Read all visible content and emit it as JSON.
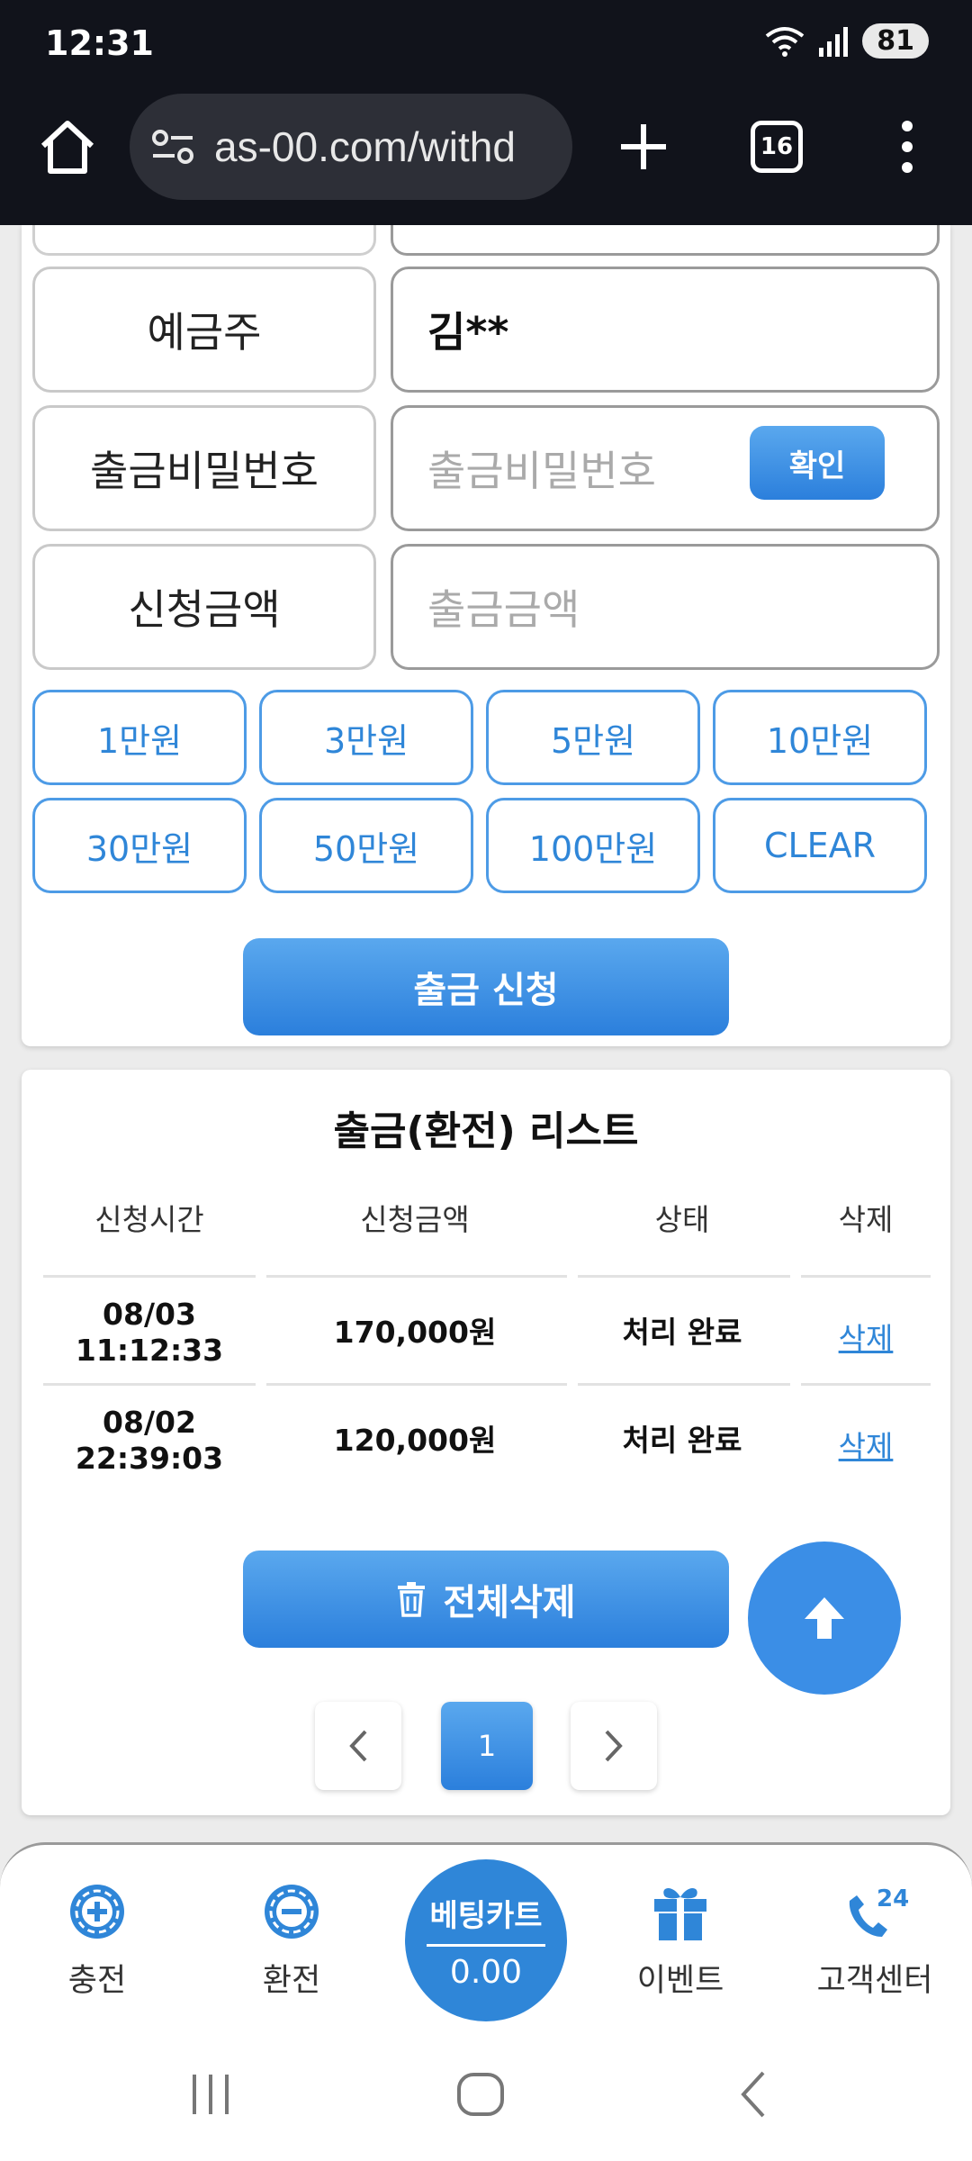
{
  "status": {
    "time": "12:31",
    "battery": "81"
  },
  "browser": {
    "url": "as-00.com/withd",
    "tab_count": "16"
  },
  "form": {
    "depositor_label": "예금주",
    "depositor_value": "김**",
    "password_label": "출금비밀번호",
    "password_placeholder": "출금비밀번호",
    "confirm_label": "확인",
    "amount_label": "신청금액",
    "amount_placeholder": "출금금액",
    "amount_buttons": [
      "1만원",
      "3만원",
      "5만원",
      "10만원",
      "30만원",
      "50만원",
      "100만원",
      "CLEAR"
    ],
    "submit_label": "출금 신청"
  },
  "list": {
    "title": "출금(환전) 리스트",
    "headers": [
      "신청시간",
      "신청금액",
      "상태",
      "삭제"
    ],
    "rows": [
      {
        "date": "08/03",
        "time": "11:12:33",
        "amount": "170,000원",
        "status": "처리 완료",
        "delete": "삭제"
      },
      {
        "date": "08/02",
        "time": "22:39:03",
        "amount": "120,000원",
        "status": "처리 완료",
        "delete": "삭제"
      }
    ],
    "delete_all_label": "전체삭제",
    "current_page": "1"
  },
  "bottom_nav": {
    "charge": "충전",
    "exchange": "환전",
    "bet_cart_title": "베팅카트",
    "bet_cart_value": "0.00",
    "event": "이벤트",
    "support": "고객센터",
    "support_badge": "24"
  },
  "colors": {
    "accent": "#2f86d8",
    "topbar": "#11131b"
  }
}
